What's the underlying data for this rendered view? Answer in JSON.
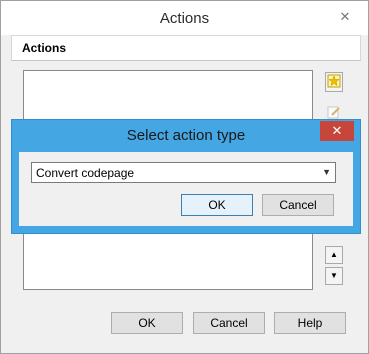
{
  "window": {
    "title": "Actions",
    "close_glyph": "✕"
  },
  "section": {
    "header": "Actions"
  },
  "side_buttons": {
    "add_icon": "add-action-icon",
    "edit_icon": "edit-action-icon",
    "up": "▲",
    "down": "▼"
  },
  "buttons": {
    "ok": "OK",
    "cancel": "Cancel",
    "help": "Help"
  },
  "dialog": {
    "title": "Select action type",
    "close_glyph": "✕",
    "select_value": "Convert codepage",
    "ok": "OK",
    "cancel": "Cancel"
  },
  "colors": {
    "dialog_frame": "#44a6e2",
    "close_red": "#c7463b"
  }
}
